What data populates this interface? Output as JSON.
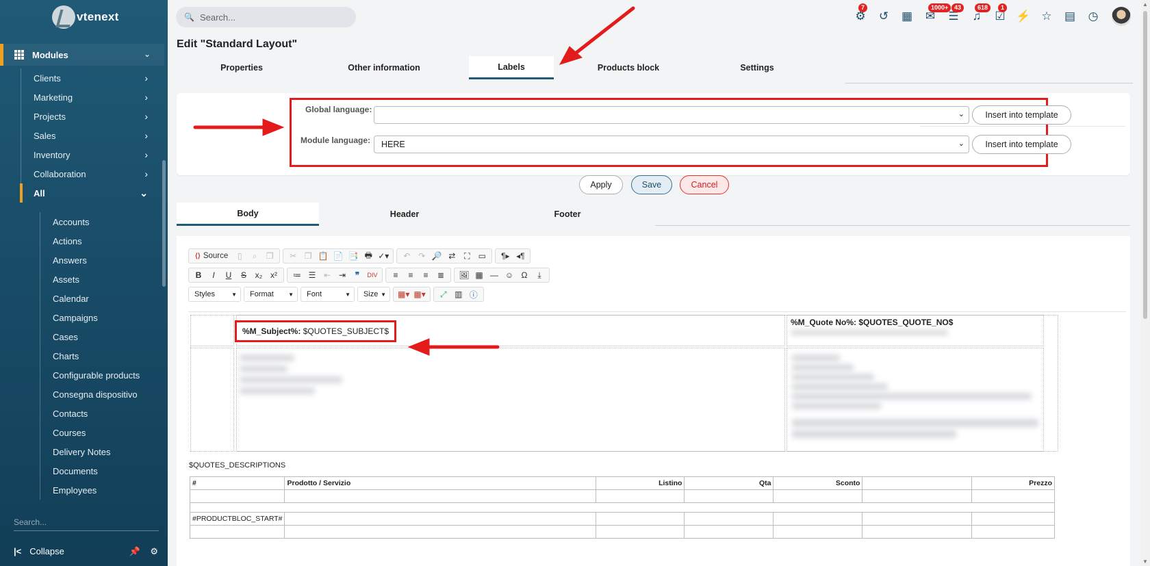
{
  "sidebar": {
    "logo_text": "vtenext",
    "modules_label": "Modules",
    "items": [
      {
        "label": "Clients"
      },
      {
        "label": "Marketing"
      },
      {
        "label": "Projects"
      },
      {
        "label": "Sales"
      },
      {
        "label": "Inventory"
      },
      {
        "label": "Collaboration"
      },
      {
        "label": "All"
      }
    ],
    "sub_items": [
      {
        "label": "Accounts"
      },
      {
        "label": "Actions"
      },
      {
        "label": "Answers"
      },
      {
        "label": "Assets"
      },
      {
        "label": "Calendar"
      },
      {
        "label": "Campaigns"
      },
      {
        "label": "Cases"
      },
      {
        "label": "Charts"
      },
      {
        "label": "Configurable products"
      },
      {
        "label": "Consegna dispositivo"
      },
      {
        "label": "Contacts"
      },
      {
        "label": "Courses"
      },
      {
        "label": "Delivery Notes"
      },
      {
        "label": "Documents"
      },
      {
        "label": "Employees"
      }
    ],
    "search_placeholder": "Search...",
    "collapse_label": "Collapse"
  },
  "topbar": {
    "search_placeholder": "Search...",
    "icons": [
      {
        "name": "processes-icon",
        "glyph": "⚙",
        "badge": "7"
      },
      {
        "name": "history-icon",
        "glyph": "↺",
        "badge": ""
      },
      {
        "name": "calendar-icon",
        "glyph": "▦",
        "badge": ""
      },
      {
        "name": "mail-icon",
        "glyph": "✉",
        "badge": "1000+"
      },
      {
        "name": "messages-icon",
        "glyph": "☰",
        "badge": "43"
      },
      {
        "name": "notifications-icon",
        "glyph": "♫",
        "badge": "618"
      },
      {
        "name": "tasks-icon",
        "glyph": "☑",
        "badge": "1"
      },
      {
        "name": "quick-actions-icon",
        "glyph": "⚡",
        "badge": ""
      },
      {
        "name": "favorites-icon",
        "glyph": "☆",
        "badge": ""
      },
      {
        "name": "notes-icon",
        "glyph": "▤",
        "badge": ""
      },
      {
        "name": "timer-icon",
        "glyph": "◷",
        "badge": ""
      }
    ]
  },
  "page": {
    "title": "Edit \"Standard Layout\"",
    "tabs": [
      "Properties",
      "Other information",
      "Labels",
      "Products block",
      "Settings"
    ],
    "active_tab": "Labels"
  },
  "labels_panel": {
    "global_label": "Global language:",
    "global_value": "",
    "module_label": "Module language:",
    "module_value": "HERE",
    "insert_btn": "Insert into template"
  },
  "actions": {
    "apply": "Apply",
    "save": "Save",
    "cancel": "Cancel"
  },
  "editor_tabs": [
    "Body",
    "Header",
    "Footer"
  ],
  "toolbar": {
    "source": "Source",
    "styles": "Styles",
    "format": "Format",
    "font": "Font",
    "size": "Size"
  },
  "document": {
    "subject_label": "%M_Subject%:",
    "subject_var": " $QUOTES_SUBJECT$",
    "quote_no": "%M_Quote No%: $QUOTES_QUOTE_NO$",
    "description": "$QUOTES_DESCRIPTIONS",
    "table_headers": [
      "#",
      "Prodotto / Servizio",
      "Listino",
      "Qta",
      "Sconto",
      "",
      "Prezzo"
    ],
    "product_start": "#PRODUCTBLOC_START#"
  },
  "colors": {
    "sidebar": "#1f5a76",
    "accent": "#f0a020",
    "annotation": "#e31b1b"
  }
}
